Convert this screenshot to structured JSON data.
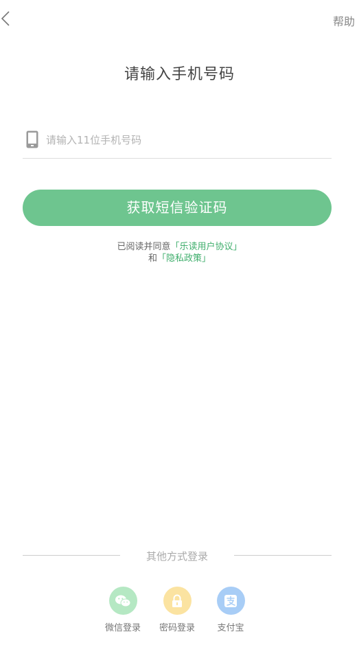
{
  "header": {
    "back_icon": "chevron-left-icon",
    "help_label": "帮助"
  },
  "title": "请输入手机号码",
  "phone_input": {
    "icon": "mobile-phone-icon",
    "value": "",
    "placeholder": "请输入11位手机号码"
  },
  "submit_label": "获取短信验证码",
  "agreement": {
    "prefix": "已阅读并同意",
    "open_bracket": "「",
    "close_bracket": "」",
    "user_agreement": "乐读用户协议",
    "connector": "和",
    "privacy_policy": "隐私政策"
  },
  "other_login": {
    "divider_label": "其他方式登录",
    "options": [
      {
        "label": "微信登录",
        "icon": "wechat-icon",
        "color": "#b5e8c3"
      },
      {
        "label": "密码登录",
        "icon": "lock-icon",
        "color": "#fbe3a1"
      },
      {
        "label": "支付宝",
        "icon": "alipay-icon",
        "color": "#a8cdf6"
      }
    ]
  },
  "colors": {
    "primary": "#6ec58f",
    "link": "#3fae6c"
  }
}
